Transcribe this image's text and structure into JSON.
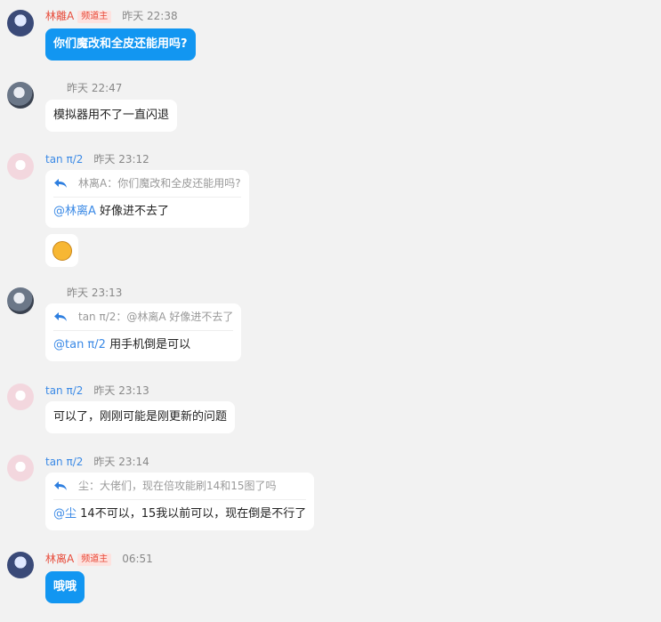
{
  "messages": [
    {
      "name": "林離A",
      "badge": "频道主",
      "time": "昨天 22:38",
      "text": "你们魔改和全皮还能用吗?"
    },
    {
      "time": "昨天 22:47",
      "text": "模拟器用不了一直闪退"
    },
    {
      "name": "tan π/2",
      "time": "昨天 23:12",
      "quote": "林离A：你们魔改和全皮还能用吗?",
      "mention": "@林离A",
      "text": "好像进不去了",
      "emoji": "emoji-sticker-icon"
    },
    {
      "time": "昨天 23:13",
      "quote": "tan π/2：@林离A 好像进不去了",
      "mention": "@tan π/2",
      "text": "用手机倒是可以"
    },
    {
      "name": "tan π/2",
      "time": "昨天 23:13",
      "text": "可以了，刚刚可能是刚更新的问题"
    },
    {
      "name": "tan π/2",
      "time": "昨天 23:14",
      "quote": "尘：大佬们，现在倍攻能刷14和15图了吗",
      "mention": "@尘",
      "text": "14不可以，15我以前可以，现在倒是不行了"
    },
    {
      "name": "林离A",
      "badge": "频道主",
      "time": "06:51",
      "text": "哦哦"
    }
  ],
  "colors": {
    "owner_name": "#e84b3a",
    "member_name": "#3b8ae6",
    "bubble_blue": "#1296f1",
    "background": "#f2f2f2"
  }
}
